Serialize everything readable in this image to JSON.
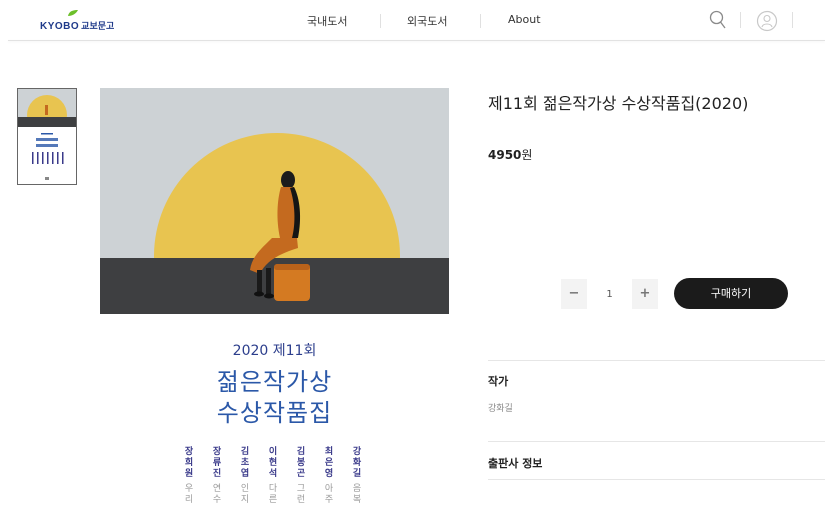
{
  "header": {
    "logo_main": "KYOBO",
    "logo_sub": "교보문고",
    "nav": [
      {
        "label": "국내도서"
      },
      {
        "label": "외국도서"
      },
      {
        "label": "About"
      }
    ],
    "icons": [
      "search-icon",
      "user-icon"
    ]
  },
  "product": {
    "title": "제11회 젊은작가상 수상작품집(2020)",
    "price_number": "4950",
    "price_unit": "원",
    "quantity": "1",
    "minus_label": "−",
    "plus_label": "+",
    "buy_label": "구매하기"
  },
  "cover": {
    "year_line": "2020 제11회",
    "title_line1": "젊은작가상",
    "title_line2": "수상작품집",
    "authors": [
      {
        "name": "장희원",
        "work": "우리"
      },
      {
        "name": "장류진",
        "work": "연수"
      },
      {
        "name": "김초엽",
        "work": "인지"
      },
      {
        "name": "이현석",
        "work": "다른"
      },
      {
        "name": "김봉곤",
        "work": "그런"
      },
      {
        "name": "최은영",
        "work": "아주"
      },
      {
        "name": "강화길",
        "work": "음복"
      }
    ]
  },
  "sections": {
    "author_title": "작가",
    "author_value": "강화길",
    "publisher_title": "출판사 정보"
  },
  "colors": {
    "sun_yellow": "#e8c450",
    "sky_gray": "#cdd2d5",
    "floor_dark": "#3e3f41",
    "cover_blue": "#2b58a8",
    "button_black": "#1b1b1b"
  }
}
